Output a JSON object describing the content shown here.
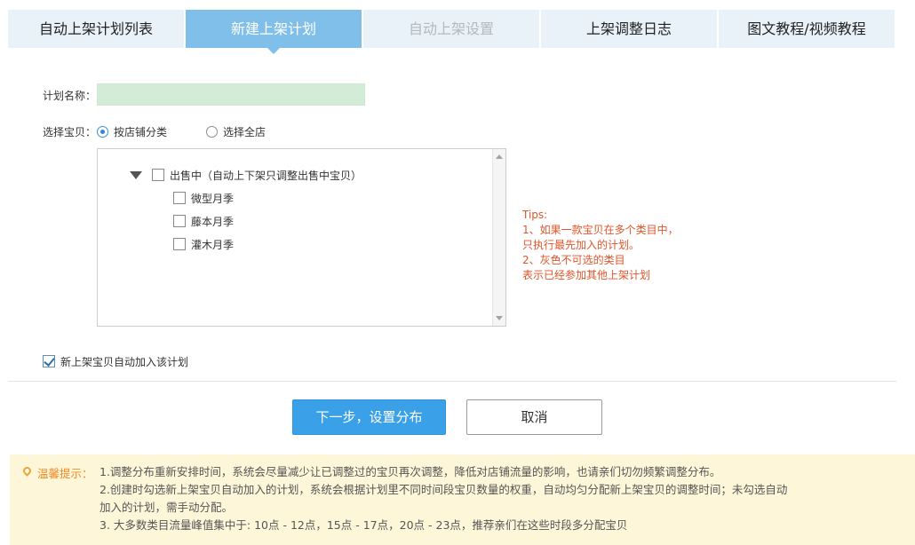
{
  "tabs": [
    {
      "label": "自动上架计划列表",
      "state": "normal"
    },
    {
      "label": "新建上架计划",
      "state": "active"
    },
    {
      "label": "自动上架设置",
      "state": "disabled"
    },
    {
      "label": "上架调整日志",
      "state": "normal"
    },
    {
      "label": "图文教程/视频教程",
      "state": "normal"
    }
  ],
  "form": {
    "plan_name_label": "计划名称：",
    "plan_name_value": "",
    "select_label": "选择宝贝：",
    "radio_by_category": "按店铺分类",
    "radio_whole_store": "选择全店",
    "selected_radio": "by_category"
  },
  "tree": {
    "root": {
      "label": "出售中（自动上下架只调整出售中宝贝）",
      "checked": false,
      "expanded": true
    },
    "children": [
      {
        "label": "微型月季",
        "checked": false
      },
      {
        "label": "藤本月季",
        "checked": false
      },
      {
        "label": "灌木月季",
        "checked": false
      }
    ]
  },
  "tips": {
    "title": "Tips:",
    "line1": "1、如果一款宝贝在多个类目中，",
    "line2": "只执行最先加入的计划。",
    "line3": "2、灰色不可选的类目",
    "line4": "表示已经参加其他上架计划"
  },
  "auto_add": {
    "label": "新上架宝贝自动加入该计划",
    "checked": true
  },
  "buttons": {
    "next": "下一步，设置分布",
    "cancel": "取消"
  },
  "notice": {
    "title": "温馨提示：",
    "line1": "1.调整分布重新安排时间，系统会尽量减少让已调整过的宝贝再次调整，降低对店铺流量的影响，也请亲们切勿频繁调整分布。",
    "line2": "2.创建时勾选新上架宝贝自动加入的计划，系统会根据计划里不同时间段宝贝数量的权重，自动均匀分配新上架宝贝的调整时间；未勾选自动",
    "line3": "加入的计划，需手动分配。",
    "line4": "3. 大多数类目流量峰值集中于: 10点 - 12点，15点 - 17点，20点 - 23点，推荐亲们在这些时段多分配宝贝"
  },
  "colors": {
    "tab_active": "#7fbfe9",
    "tab_bg": "#e9f2f8",
    "primary_button": "#3aa0e8",
    "tips_text": "#e0552a",
    "notice_bg": "#fdf6d9",
    "notice_title": "#f08a24",
    "input_bg": "#d3ecd7"
  },
  "icons": {
    "tree_toggle": "triangle-down-icon",
    "notice": "location-pin-icon",
    "scroll_up": "arrow-up-icon",
    "scroll_down": "arrow-down-icon"
  }
}
